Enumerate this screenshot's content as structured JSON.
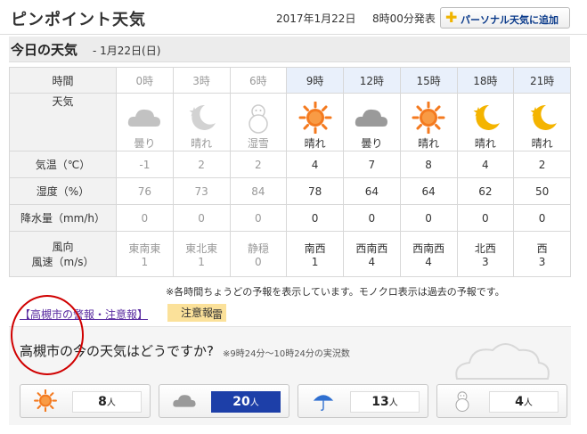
{
  "header": {
    "title": "ピンポイント天気",
    "date": "2017年1月22日",
    "time": "8時00分発表",
    "personal_button": "パーソナル天気に追加"
  },
  "day": {
    "title": "今日の天気",
    "date": "- 1月22日(日)"
  },
  "table": {
    "row_labels": {
      "time": "時間",
      "weather": "天気",
      "temp": "気温（℃）",
      "humidity": "湿度（%）",
      "precip": "降水量（mm/h）",
      "wind_dir": "風向",
      "wind_speed": "風速（m/s）"
    },
    "hours": [
      {
        "time": "0時",
        "weather": "曇り",
        "icon": "cloud-icon",
        "temp": "-1",
        "humidity": "76",
        "precip": "0",
        "wind_dir": "東南東",
        "wind_speed": "1",
        "past": true
      },
      {
        "time": "3時",
        "weather": "晴れ",
        "icon": "moon-star-icon",
        "temp": "2",
        "humidity": "73",
        "precip": "0",
        "wind_dir": "東北東",
        "wind_speed": "1",
        "past": true
      },
      {
        "time": "6時",
        "weather": "湿雪",
        "icon": "snowman-icon",
        "temp": "2",
        "humidity": "84",
        "precip": "0",
        "wind_dir": "静穏",
        "wind_speed": "0",
        "past": true
      },
      {
        "time": "9時",
        "weather": "晴れ",
        "icon": "sun-icon",
        "temp": "4",
        "humidity": "78",
        "precip": "0",
        "wind_dir": "南西",
        "wind_speed": "1",
        "past": false
      },
      {
        "time": "12時",
        "weather": "曇り",
        "icon": "cloud-icon",
        "temp": "7",
        "humidity": "64",
        "precip": "0",
        "wind_dir": "西南西",
        "wind_speed": "4",
        "past": false
      },
      {
        "time": "15時",
        "weather": "晴れ",
        "icon": "sun-icon",
        "temp": "8",
        "humidity": "64",
        "precip": "0",
        "wind_dir": "西南西",
        "wind_speed": "4",
        "past": false
      },
      {
        "time": "18時",
        "weather": "晴れ",
        "icon": "moon-star-icon",
        "temp": "4",
        "humidity": "62",
        "precip": "0",
        "wind_dir": "北西",
        "wind_speed": "3",
        "past": false
      },
      {
        "time": "21時",
        "weather": "晴れ",
        "icon": "moon-star-icon",
        "temp": "2",
        "humidity": "50",
        "precip": "0",
        "wind_dir": "西",
        "wind_speed": "3",
        "past": false
      }
    ]
  },
  "note": "※各時間ちょうどの予報を表示しています。モノクロ表示は過去の予報です。",
  "warning": {
    "link": "【高槻市の警報・注意報】",
    "badge": "注意報",
    "item": "雷"
  },
  "survey": {
    "question": "高槻市の今の天気はどうですか?",
    "subnote": "※9時24分～10時24分の実況数",
    "votes": [
      {
        "icon": "sun-icon",
        "count": "8",
        "unit": "人",
        "selected": false
      },
      {
        "icon": "cloud-icon",
        "count": "20",
        "unit": "人",
        "selected": true
      },
      {
        "icon": "umbrella-icon",
        "count": "13",
        "unit": "人",
        "selected": false
      },
      {
        "icon": "snowman-icon",
        "count": "4",
        "unit": "人",
        "selected": false
      }
    ]
  },
  "colors": {
    "sun": "#f47a1f",
    "moon": "#f4b400",
    "cloud": "#9a9a9a",
    "selected": "#1d3fa8",
    "annotation": "#d00000"
  }
}
